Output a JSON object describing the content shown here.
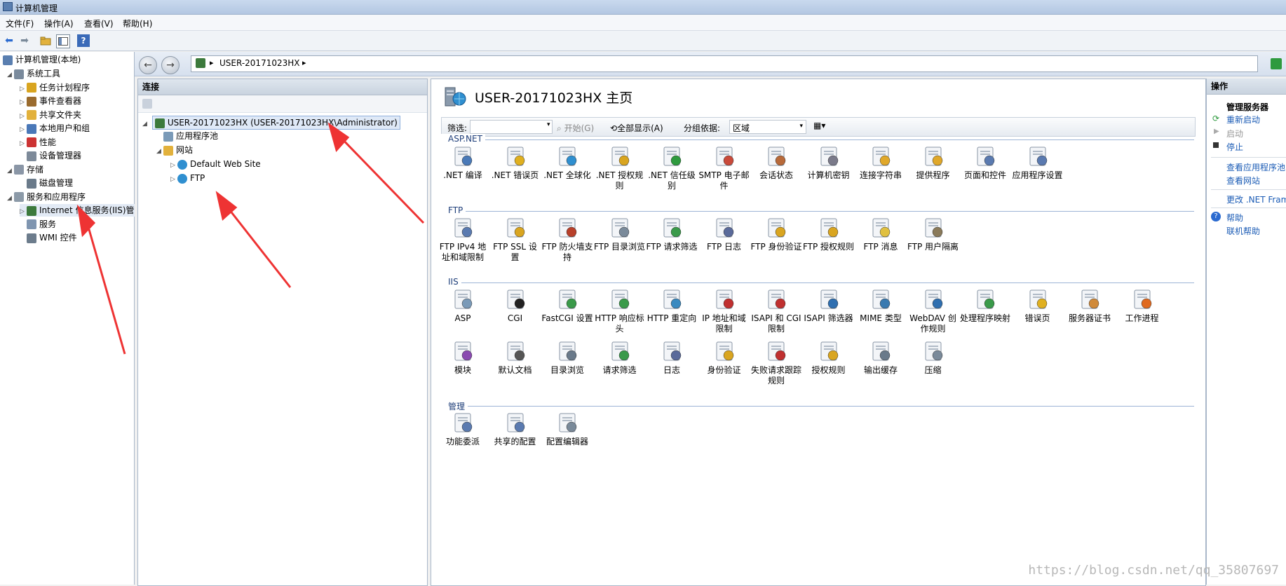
{
  "window": {
    "title": "计算机管理"
  },
  "menu": [
    "文件(F)",
    "操作(A)",
    "查看(V)",
    "帮助(H)"
  ],
  "left_tree": {
    "root": "计算机管理(本地)",
    "items": [
      {
        "label": "系统工具",
        "level": 1,
        "expand": "◢",
        "icon": "toolbox-icon",
        "color": "#7a8a9c"
      },
      {
        "label": "任务计划程序",
        "level": 2,
        "expand": "▷",
        "icon": "clock-icon",
        "color": "#d9a520"
      },
      {
        "label": "事件查看器",
        "level": 2,
        "expand": "▷",
        "icon": "event-log-icon",
        "color": "#9a6b2e"
      },
      {
        "label": "共享文件夹",
        "level": 2,
        "expand": "▷",
        "icon": "shared-folder-icon",
        "color": "#e2b13c"
      },
      {
        "label": "本地用户和组",
        "level": 2,
        "expand": "▷",
        "icon": "users-icon",
        "color": "#4a78b8"
      },
      {
        "label": "性能",
        "level": 2,
        "expand": "▷",
        "icon": "performance-icon",
        "color": "#c33"
      },
      {
        "label": "设备管理器",
        "level": 2,
        "expand": "",
        "icon": "device-manager-icon",
        "color": "#7d8a99"
      },
      {
        "label": "存储",
        "level": 1,
        "expand": "◢",
        "icon": "storage-icon",
        "color": "#8a96a6"
      },
      {
        "label": "磁盘管理",
        "level": 2,
        "expand": "",
        "icon": "disk-icon",
        "color": "#6a7a8a"
      },
      {
        "label": "服务和应用程序",
        "level": 1,
        "expand": "◢",
        "icon": "services-apps-icon",
        "color": "#8c9aa8"
      },
      {
        "label": "Internet 信息服务(IIS)管",
        "level": 2,
        "expand": "▷",
        "icon": "iis-icon",
        "color": "#3c7a3c"
      },
      {
        "label": "服务",
        "level": 2,
        "expand": "",
        "icon": "services-icon",
        "color": "#7f95b0"
      },
      {
        "label": "WMI 控件",
        "level": 2,
        "expand": "",
        "icon": "wmi-icon",
        "color": "#6c7c8c"
      }
    ]
  },
  "address": {
    "path": "USER-20171023HX",
    "sep1": "▸",
    "sep2": "▸"
  },
  "connections": {
    "title": "连接",
    "server": "USER-20171023HX (USER-20171023HX\\Administrator)",
    "app_pools": "应用程序池",
    "sites": "网站",
    "site1": "Default Web Site",
    "site2": "FTP"
  },
  "main": {
    "title": "USER-20171023HX 主页",
    "filter": {
      "label": "筛选:",
      "start": "开始(G)",
      "show_all": "全部显示(A)",
      "group_by": "分组依据:",
      "group_value": "区域"
    },
    "groups": [
      {
        "name": "ASP.NET",
        "items": [
          {
            "label": ".NET 编译",
            "icon": "net-compile-icon",
            "color": "#4a7ab8"
          },
          {
            "label": ".NET 错误页",
            "icon": "net-error-page-icon",
            "color": "#e0b020"
          },
          {
            "label": ".NET 全球化",
            "icon": "net-globalization-icon",
            "color": "#2f8fd0"
          },
          {
            "label": ".NET 授权规则",
            "icon": "net-authorization-icon",
            "color": "#d9a520"
          },
          {
            "label": ".NET 信任级别",
            "icon": "net-trust-icon",
            "color": "#2e9a3e"
          },
          {
            "label": "SMTP 电子邮件",
            "icon": "smtp-icon",
            "color": "#c94a3a"
          },
          {
            "label": "会话状态",
            "icon": "session-state-icon",
            "color": "#b86a3a"
          },
          {
            "label": "计算机密钥",
            "icon": "machine-key-icon",
            "color": "#7a7a8a"
          },
          {
            "label": "连接字符串",
            "icon": "connection-strings-icon",
            "color": "#e0a82a"
          },
          {
            "label": "提供程序",
            "icon": "providers-icon",
            "color": "#e0a82a"
          },
          {
            "label": "页面和控件",
            "icon": "pages-controls-icon",
            "color": "#5a7ab0"
          },
          {
            "label": "应用程序设置",
            "icon": "app-settings-icon",
            "color": "#5a7ab0"
          }
        ]
      },
      {
        "name": "FTP",
        "items": [
          {
            "label": "FTP IPv4 地址和域限制",
            "icon": "ftp-ip-restrict-icon",
            "color": "#5a7ab0"
          },
          {
            "label": "FTP SSL 设置",
            "icon": "ftp-ssl-icon",
            "color": "#d9a520"
          },
          {
            "label": "FTP 防火墙支持",
            "icon": "ftp-firewall-icon",
            "color": "#b8402a"
          },
          {
            "label": "FTP 目录浏览",
            "icon": "ftp-dir-browse-icon",
            "color": "#7a8a9a"
          },
          {
            "label": "FTP 请求筛选",
            "icon": "ftp-request-filter-icon",
            "color": "#3a9a4a"
          },
          {
            "label": "FTP 日志",
            "icon": "ftp-log-icon",
            "color": "#5a6a9a"
          },
          {
            "label": "FTP 身份验证",
            "icon": "ftp-auth-icon",
            "color": "#d9a520"
          },
          {
            "label": "FTP 授权规则",
            "icon": "ftp-authz-icon",
            "color": "#d9a520"
          },
          {
            "label": "FTP 消息",
            "icon": "ftp-message-icon",
            "color": "#e0c040"
          },
          {
            "label": "FTP 用户隔离",
            "icon": "ftp-user-isolation-icon",
            "color": "#8a7a5a"
          }
        ]
      },
      {
        "name": "IIS",
        "items": [
          {
            "label": "ASP",
            "icon": "asp-icon",
            "color": "#7a9ab8"
          },
          {
            "label": "CGI",
            "icon": "cgi-icon",
            "color": "#222222"
          },
          {
            "label": "FastCGI 设置",
            "icon": "fastcgi-icon",
            "color": "#3a9a4a"
          },
          {
            "label": "HTTP 响应标头",
            "icon": "http-headers-icon",
            "color": "#3a9a4a"
          },
          {
            "label": "HTTP 重定向",
            "icon": "http-redirect-icon",
            "color": "#3a8ac0"
          },
          {
            "label": "IP 地址和域限制",
            "icon": "ip-restrict-icon",
            "color": "#c03030"
          },
          {
            "label": "ISAPI 和 CGI 限制",
            "icon": "isapi-cgi-icon",
            "color": "#c03030"
          },
          {
            "label": "ISAPI 筛选器",
            "icon": "isapi-filter-icon",
            "color": "#2f6fb0"
          },
          {
            "label": "MIME 类型",
            "icon": "mime-icon",
            "color": "#3a7ab0"
          },
          {
            "label": "WebDAV 创作规则",
            "icon": "webdav-icon",
            "color": "#2f6fb0"
          },
          {
            "label": "处理程序映射",
            "icon": "handler-mapping-icon",
            "color": "#3a9a4a"
          },
          {
            "label": "错误页",
            "icon": "error-page-icon",
            "color": "#e0b020"
          },
          {
            "label": "服务器证书",
            "icon": "server-cert-icon",
            "color": "#d08a3a"
          },
          {
            "label": "工作进程",
            "icon": "worker-process-icon",
            "color": "#e06a20"
          },
          {
            "label": "模块",
            "icon": "modules-icon",
            "color": "#8a4ab0"
          },
          {
            "label": "默认文档",
            "icon": "default-doc-icon",
            "color": "#555555"
          },
          {
            "label": "目录浏览",
            "icon": "dir-browse-icon",
            "color": "#6a7a8a"
          },
          {
            "label": "请求筛选",
            "icon": "request-filter-icon",
            "color": "#3a9a4a"
          },
          {
            "label": "日志",
            "icon": "log-icon",
            "color": "#5a6a9a"
          },
          {
            "label": "身份验证",
            "icon": "authentication-icon",
            "color": "#d9a520"
          },
          {
            "label": "失败请求跟踪规则",
            "icon": "failed-request-icon",
            "color": "#c03030"
          },
          {
            "label": "授权规则",
            "icon": "authorization-icon",
            "color": "#d9a520"
          },
          {
            "label": "输出缓存",
            "icon": "output-cache-icon",
            "color": "#6a7a8a"
          },
          {
            "label": "压缩",
            "icon": "compression-icon",
            "color": "#7a8a9a"
          }
        ]
      },
      {
        "name": "管理",
        "items": [
          {
            "label": "功能委派",
            "icon": "feature-delegation-icon",
            "color": "#5a7ab0"
          },
          {
            "label": "共享的配置",
            "icon": "shared-config-icon",
            "color": "#5a7ab0"
          },
          {
            "label": "配置编辑器",
            "icon": "config-editor-icon",
            "color": "#7a8a9a"
          }
        ]
      }
    ]
  },
  "actions": {
    "title": "操作",
    "manage_server": "管理服务器",
    "restart": "重新启动",
    "start": "启动",
    "stop": "停止",
    "view_app_pools": "查看应用程序池",
    "view_sites": "查看网站",
    "change_net": "更改 .NET Framew",
    "help": "帮助",
    "online_help": "联机帮助"
  },
  "watermark": "https://blog.csdn.net/qq_35807697",
  "colors": {
    "accent": "#1a5bb5",
    "arrow": "#ee3333"
  }
}
